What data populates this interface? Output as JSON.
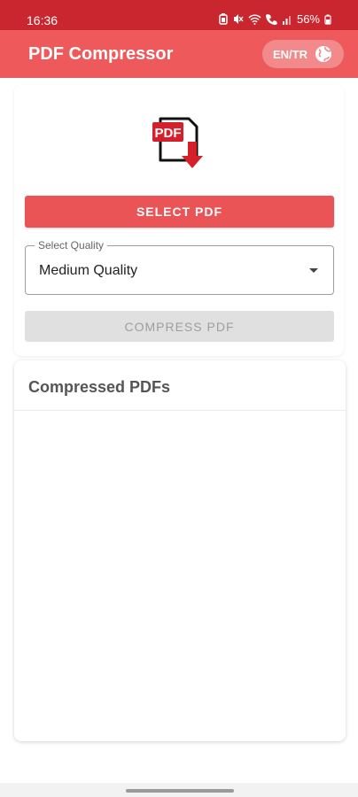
{
  "status_bar": {
    "time": "16:36",
    "battery": "56%"
  },
  "app_bar": {
    "title": "PDF Compressor",
    "language_label": "EN/TR"
  },
  "colors": {
    "status_bar": "#c9262f",
    "app_bar": "#ee5a5c",
    "primary_button": "#ea5457",
    "disabled_button": "#e0e0e0"
  },
  "main": {
    "select_button": "SELECT PDF",
    "quality": {
      "legend": "Select Quality",
      "value": "Medium Quality"
    },
    "compress_button": "COMPRESS PDF"
  },
  "compressed_list": {
    "title": "Compressed PDFs",
    "items": []
  }
}
